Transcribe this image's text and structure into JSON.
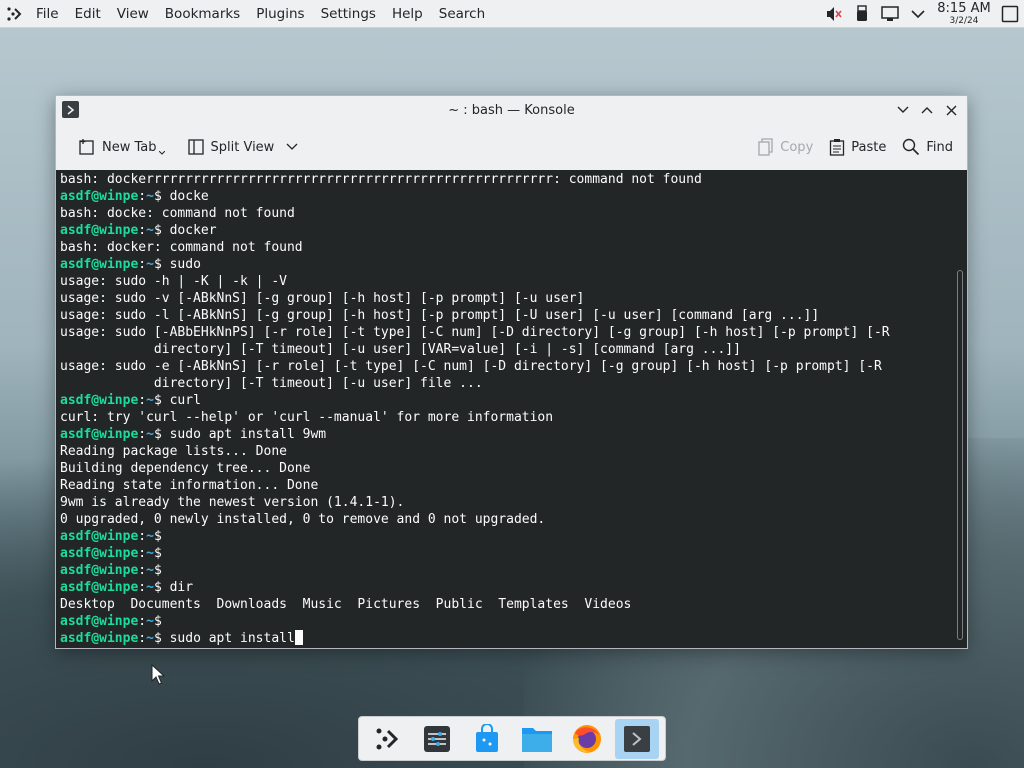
{
  "top_panel": {
    "menus": [
      "File",
      "Edit",
      "View",
      "Bookmarks",
      "Plugins",
      "Settings",
      "Help",
      "Search"
    ],
    "clock": {
      "time": "8:15 AM",
      "date": "3/2/24"
    }
  },
  "window": {
    "title": "~ : bash — Konsole",
    "toolbar": {
      "new_tab": "New Tab",
      "split_view": "Split View",
      "copy": "Copy",
      "paste": "Paste",
      "find": "Find"
    }
  },
  "terminal": {
    "prompt": {
      "user": "asdf@winpe",
      "path": "~"
    },
    "lines": [
      {
        "type": "out",
        "text": "bash: dockerrrrrrrrrrrrrrrrrrrrrrrrrrrrrrrrrrrrrrrrrrrrrrrrrrrr: command not found"
      },
      {
        "type": "cmd",
        "text": "docke"
      },
      {
        "type": "out",
        "text": "bash: docke: command not found"
      },
      {
        "type": "cmd",
        "text": "docker"
      },
      {
        "type": "out",
        "text": "bash: docker: command not found"
      },
      {
        "type": "cmd",
        "text": "sudo"
      },
      {
        "type": "out",
        "text": "usage: sudo -h | -K | -k | -V"
      },
      {
        "type": "out",
        "text": "usage: sudo -v [-ABkNnS] [-g group] [-h host] [-p prompt] [-u user]"
      },
      {
        "type": "out",
        "text": "usage: sudo -l [-ABkNnS] [-g group] [-h host] [-p prompt] [-U user] [-u user] [command [arg ...]]"
      },
      {
        "type": "out",
        "text": "usage: sudo [-ABbEHkNnPS] [-r role] [-t type] [-C num] [-D directory] [-g group] [-h host] [-p prompt] [-R"
      },
      {
        "type": "out",
        "text": "            directory] [-T timeout] [-u user] [VAR=value] [-i | -s] [command [arg ...]]"
      },
      {
        "type": "out",
        "text": "usage: sudo -e [-ABkNnS] [-r role] [-t type] [-C num] [-D directory] [-g group] [-h host] [-p prompt] [-R"
      },
      {
        "type": "out",
        "text": "            directory] [-T timeout] [-u user] file ..."
      },
      {
        "type": "cmd",
        "text": "curl"
      },
      {
        "type": "out",
        "text": "curl: try 'curl --help' or 'curl --manual' for more information"
      },
      {
        "type": "cmd",
        "text": "sudo apt install 9wm"
      },
      {
        "type": "out",
        "text": "Reading package lists... Done"
      },
      {
        "type": "out",
        "text": "Building dependency tree... Done"
      },
      {
        "type": "out",
        "text": "Reading state information... Done"
      },
      {
        "type": "out",
        "text": "9wm is already the newest version (1.4.1-1)."
      },
      {
        "type": "out",
        "text": "0 upgraded, 0 newly installed, 0 to remove and 0 not upgraded."
      },
      {
        "type": "cmd",
        "text": ""
      },
      {
        "type": "cmd",
        "text": ""
      },
      {
        "type": "cmd",
        "text": ""
      },
      {
        "type": "cmd",
        "text": "dir"
      },
      {
        "type": "out",
        "text": "Desktop  Documents  Downloads  Music  Pictures  Public  Templates  Videos"
      },
      {
        "type": "cmd",
        "text": ""
      },
      {
        "type": "cmd",
        "text": "sudo apt install",
        "cursor": true
      }
    ]
  },
  "dock": {
    "items": [
      "application-launcher-icon",
      "system-settings-icon",
      "discover-store-icon",
      "file-manager-icon",
      "firefox-icon",
      "konsole-icon"
    ]
  }
}
